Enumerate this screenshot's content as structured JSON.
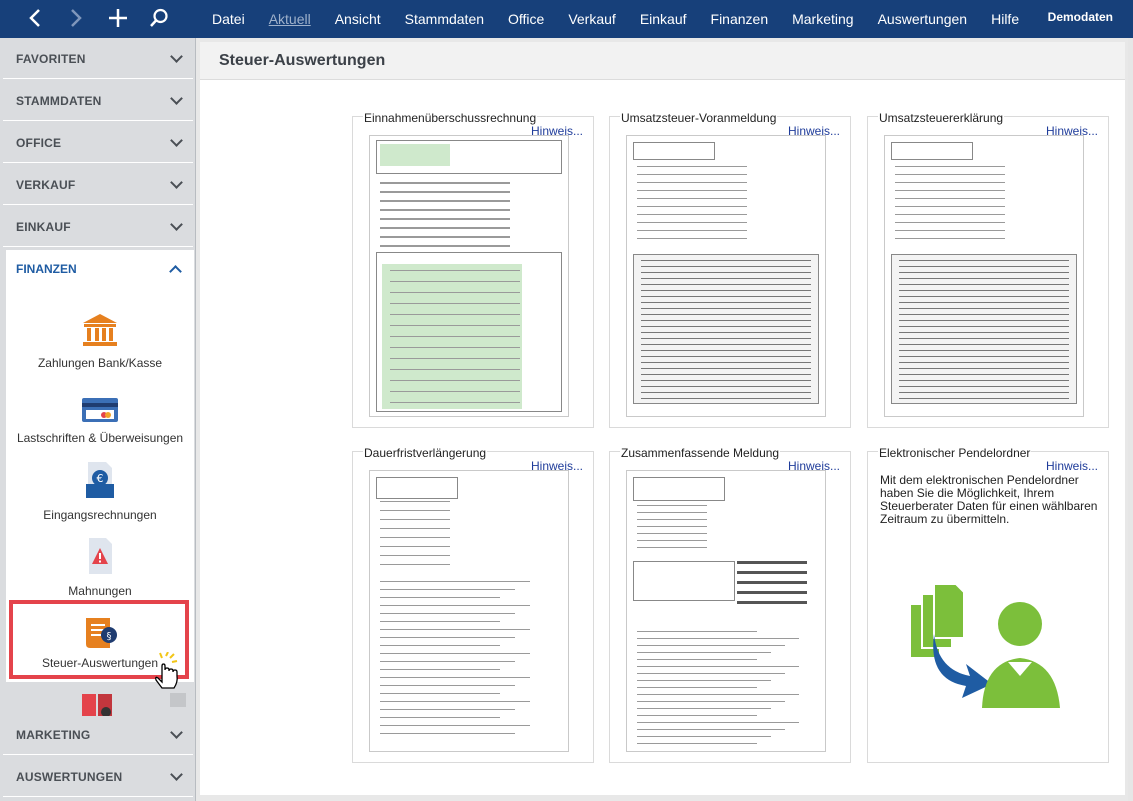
{
  "toolbar": {
    "back_icon": "chevron-left-icon",
    "forward_icon": "chevron-right-icon",
    "new_icon": "plus-icon",
    "search_icon": "search-icon"
  },
  "menu": {
    "items": [
      "Datei",
      "Aktuell",
      "Ansicht",
      "Stammdaten",
      "Office",
      "Verkauf",
      "Einkauf",
      "Finanzen",
      "Marketing",
      "Auswertungen",
      "Hilfe"
    ],
    "active": "Aktuell",
    "user": "Demodaten"
  },
  "sidebar": {
    "sections": [
      "FAVORITEN",
      "STAMMDATEN",
      "OFFICE",
      "VERKAUF",
      "EINKAUF"
    ],
    "open_section": "FINANZEN",
    "bottom_sections": [
      "MARKETING",
      "AUSWERTUNGEN"
    ],
    "finanzen_items": [
      {
        "label": "Zahlungen Bank/Kasse",
        "icon": "bank-icon"
      },
      {
        "label": "Lastschriften & Überweisungen",
        "icon": "credit-card-icon"
      },
      {
        "label": "Eingangsrechnungen",
        "icon": "invoice-euro-icon"
      },
      {
        "label": "Mahnungen",
        "icon": "warning-document-icon"
      },
      {
        "label": "Steuer-Auswertungen",
        "icon": "tax-scroll-icon"
      }
    ],
    "selected": "Steuer-Auswertungen"
  },
  "page": {
    "title": "Steuer-Auswertungen",
    "hint_label": "Hinweis...",
    "cards": [
      {
        "title": "Einnahmenüberschussrechnung",
        "type": "form-thumbnail"
      },
      {
        "title": "Umsatzsteuer-Voranmeldung",
        "type": "form-thumbnail"
      },
      {
        "title": "Umsatzsteuererklärung",
        "type": "form-thumbnail"
      },
      {
        "title": "Dauerfristverlängerung",
        "type": "form-thumbnail"
      },
      {
        "title": "Zusammenfassende Meldung",
        "type": "form-thumbnail"
      },
      {
        "title": "Elektronischer Pendelordner",
        "type": "text",
        "text": "Mit dem elektronischen Pendelordner haben Sie die Möglichkeit, Ihrem Steuerberater Daten für einen wählbaren Zeitraum zu übermitteln.",
        "icon": "document-transfer-user-icon"
      }
    ]
  },
  "colors": {
    "topbar": "#17407a",
    "accent_blue": "#1f5ca3",
    "highlight_red": "#e4434b",
    "form_green": "#cfe9cc",
    "illustration_green": "#7cbf3b",
    "illustration_blue": "#1f5ca3"
  }
}
